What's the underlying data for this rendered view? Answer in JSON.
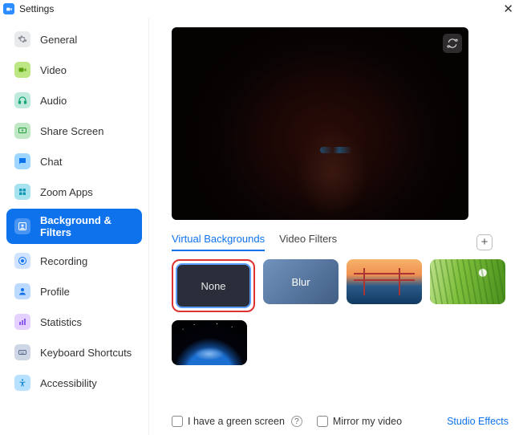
{
  "window": {
    "title": "Settings"
  },
  "sidebar": {
    "items": [
      {
        "label": "General",
        "icon": "gear-icon",
        "bg": "#e9eaec",
        "fg": "#8b8f97"
      },
      {
        "label": "Video",
        "icon": "video-icon",
        "bg": "#bce784",
        "fg": "#5aa011"
      },
      {
        "label": "Audio",
        "icon": "headphones-icon",
        "bg": "#bfe9dd",
        "fg": "#17a673"
      },
      {
        "label": "Share Screen",
        "icon": "share-screen-icon",
        "bg": "#bfe7c4",
        "fg": "#1f9d3c"
      },
      {
        "label": "Chat",
        "icon": "chat-icon",
        "bg": "#9fd6ff",
        "fg": "#0e72ed"
      },
      {
        "label": "Zoom Apps",
        "icon": "apps-icon",
        "bg": "#a7e3ef",
        "fg": "#1598b6"
      },
      {
        "label": "Background & Filters",
        "icon": "user-square-icon",
        "bg": "#0E72ED",
        "fg": "#ffffff",
        "active": true
      },
      {
        "label": "Recording",
        "icon": "record-icon",
        "bg": "#cfe3ff",
        "fg": "#0e72ed"
      },
      {
        "label": "Profile",
        "icon": "profile-icon",
        "bg": "#bcd9ff",
        "fg": "#0e72ed"
      },
      {
        "label": "Statistics",
        "icon": "statistics-icon",
        "bg": "#e4d1ff",
        "fg": "#8a5cf0"
      },
      {
        "label": "Keyboard Shortcuts",
        "icon": "keyboard-icon",
        "bg": "#cfd6e6",
        "fg": "#5a6b8c"
      },
      {
        "label": "Accessibility",
        "icon": "accessibility-icon",
        "bg": "#b7e1ff",
        "fg": "#1a8ad6"
      }
    ]
  },
  "preview": {
    "rotate_tooltip": "Rotate"
  },
  "tabs": {
    "virtual_backgrounds": "Virtual Backgrounds",
    "video_filters": "Video Filters",
    "add_tooltip": "+"
  },
  "thumbs": {
    "none": "None",
    "blur": "Blur",
    "bridge": "Golden Gate",
    "grass": "Grass",
    "earth": "Earth"
  },
  "footer": {
    "green_screen": "I have a green screen",
    "help": "?",
    "mirror": "Mirror my video",
    "studio": "Studio Effects"
  },
  "colors": {
    "accent": "#0E72ED",
    "highlight": "#e03131"
  }
}
